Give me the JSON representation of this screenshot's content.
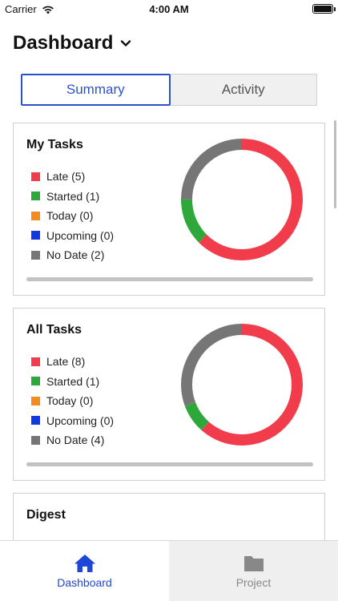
{
  "status_bar": {
    "carrier": "Carrier",
    "time": "4:00 AM",
    "icons": [
      "wifi-icon",
      "battery-icon"
    ]
  },
  "header": {
    "title": "Dashboard",
    "dropdown_icon": "chevron-down-icon"
  },
  "segmented_control": {
    "tabs": [
      {
        "label": "Summary",
        "selected": true
      },
      {
        "label": "Activity",
        "selected": false
      }
    ],
    "accent": "#2b53c7"
  },
  "colors": {
    "late": "#f03c4b",
    "started": "#2fa83b",
    "today": "#f28c1e",
    "upcoming": "#1238e0",
    "no_date": "#767676"
  },
  "my_tasks": {
    "title": "My Tasks",
    "legend": [
      {
        "label": "Late (5)",
        "key": "late",
        "value": 5
      },
      {
        "label": "Started (1)",
        "key": "started",
        "value": 1
      },
      {
        "label": "Today (0)",
        "key": "today",
        "value": 0
      },
      {
        "label": "Upcoming (0)",
        "key": "upcoming",
        "value": 0
      },
      {
        "label": "No Date (2)",
        "key": "no_date",
        "value": 2
      }
    ]
  },
  "all_tasks": {
    "title": "All Tasks",
    "legend": [
      {
        "label": "Late (8)",
        "key": "late",
        "value": 8
      },
      {
        "label": "Started (1)",
        "key": "started",
        "value": 1
      },
      {
        "label": "Today (0)",
        "key": "today",
        "value": 0
      },
      {
        "label": "Upcoming (0)",
        "key": "upcoming",
        "value": 0
      },
      {
        "label": "No Date (4)",
        "key": "no_date",
        "value": 4
      }
    ]
  },
  "digest": {
    "title": "Digest"
  },
  "tab_bar": {
    "tabs": [
      {
        "label": "Dashboard",
        "icon": "home-icon",
        "selected": true
      },
      {
        "label": "Project",
        "icon": "folder-icon",
        "selected": false
      }
    ],
    "accent": "#1f46d6"
  }
}
